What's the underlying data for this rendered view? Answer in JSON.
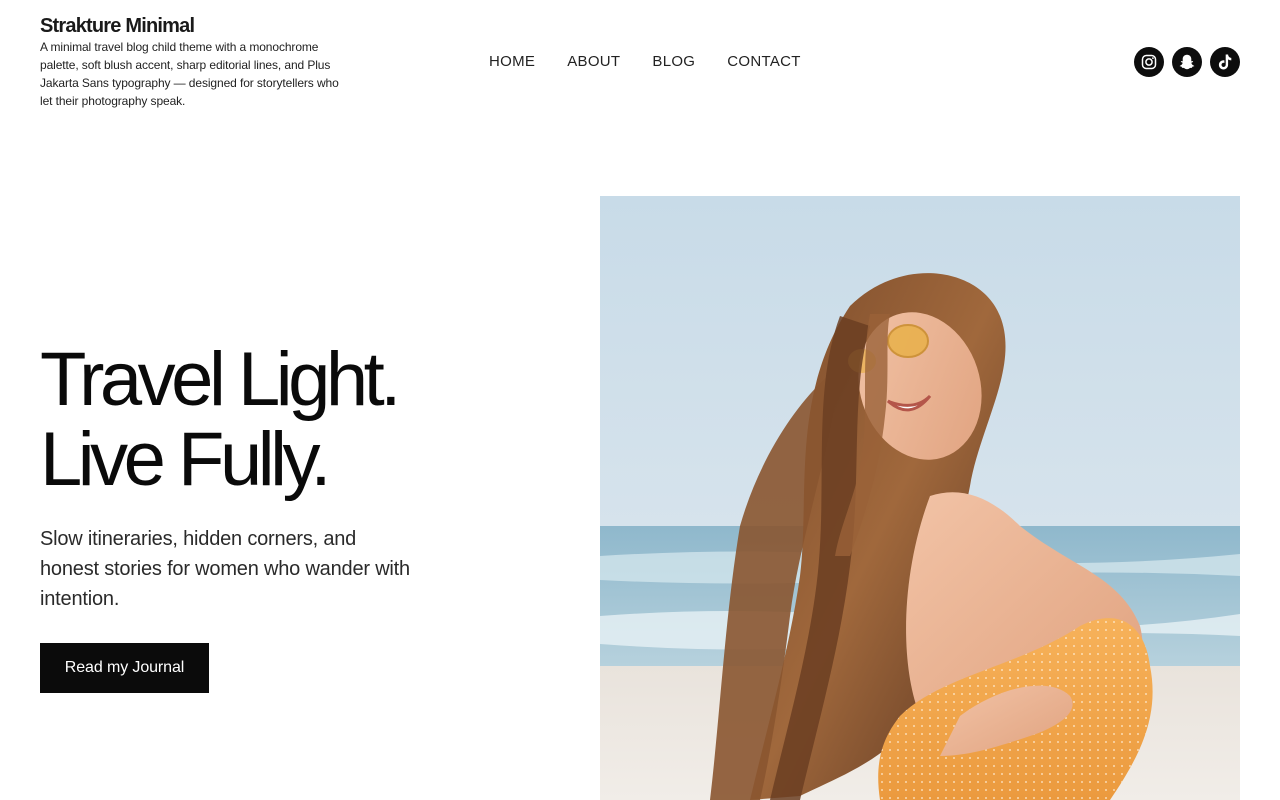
{
  "site": {
    "title": "Strakture Minimal",
    "tagline": "A minimal travel blog child theme with a monochrome palette, soft blush accent, sharp editorial lines, and Plus Jakarta Sans typography — designed for storytellers who let their photography speak."
  },
  "nav": {
    "items": [
      {
        "label": "HOME"
      },
      {
        "label": "ABOUT"
      },
      {
        "label": "BLOG"
      },
      {
        "label": "CONTACT"
      }
    ]
  },
  "socials": [
    {
      "icon": "instagram-icon"
    },
    {
      "icon": "snapchat-icon"
    },
    {
      "icon": "tiktok-icon"
    }
  ],
  "hero": {
    "headline_line1": "Travel Light.",
    "headline_line2": "Live Fully.",
    "subtext": "Slow itineraries, hidden corners, and honest stories for women who wander with intention.",
    "cta_label": "Read my Journal",
    "image": "woman-on-beach-photo"
  },
  "colors": {
    "background": "#ffffff",
    "text": "#111111",
    "button": "#0b0b0b",
    "button_text": "#ffffff",
    "social_bg": "#0d0d0d"
  }
}
